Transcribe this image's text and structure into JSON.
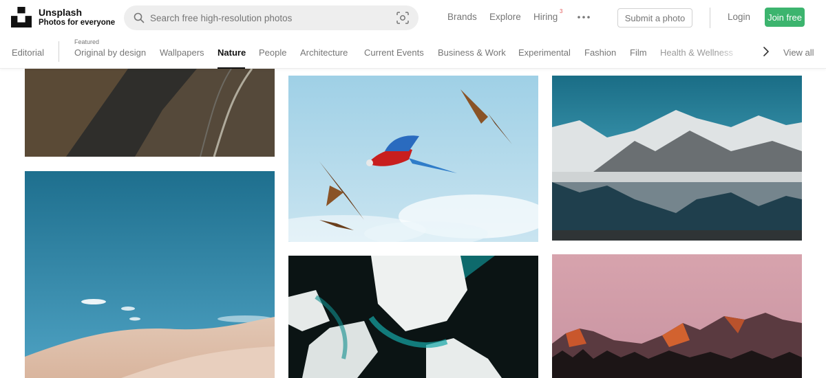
{
  "brand": {
    "name": "Unsplash",
    "tagline": "Photos for everyone"
  },
  "search": {
    "placeholder": "Search free high-resolution photos"
  },
  "nav": {
    "brands": "Brands",
    "explore": "Explore",
    "hiring": "Hiring",
    "hiring_badge": "3",
    "submit": "Submit a photo",
    "login": "Login",
    "join": "Join free"
  },
  "topics": {
    "editorial": "Editorial",
    "featured_label": "Featured",
    "items": [
      "Original by design",
      "Wallpapers",
      "Nature",
      "People",
      "Architecture",
      "Current Events",
      "Business & Work",
      "Experimental",
      "Fashion",
      "Film",
      "Health & Wellness"
    ],
    "active": "Nature",
    "view_all": "View all"
  },
  "photos": [
    {
      "subject": "aerial-landscape"
    },
    {
      "subject": "desert-dunes"
    },
    {
      "subject": "macaw-and-kites"
    },
    {
      "subject": "ice-floes"
    },
    {
      "subject": "snowy-mountain-reflection"
    },
    {
      "subject": "pink-mountains-sunset"
    }
  ],
  "colors": {
    "accent_green": "#3cb46e",
    "badge_red": "#e25c5c",
    "muted_text": "#767676"
  },
  "icons": {
    "logo": "unsplash-logo-icon",
    "search": "search-icon",
    "visual_search": "visual-search-icon",
    "more": "more-icon",
    "next": "chevron-right-icon"
  }
}
